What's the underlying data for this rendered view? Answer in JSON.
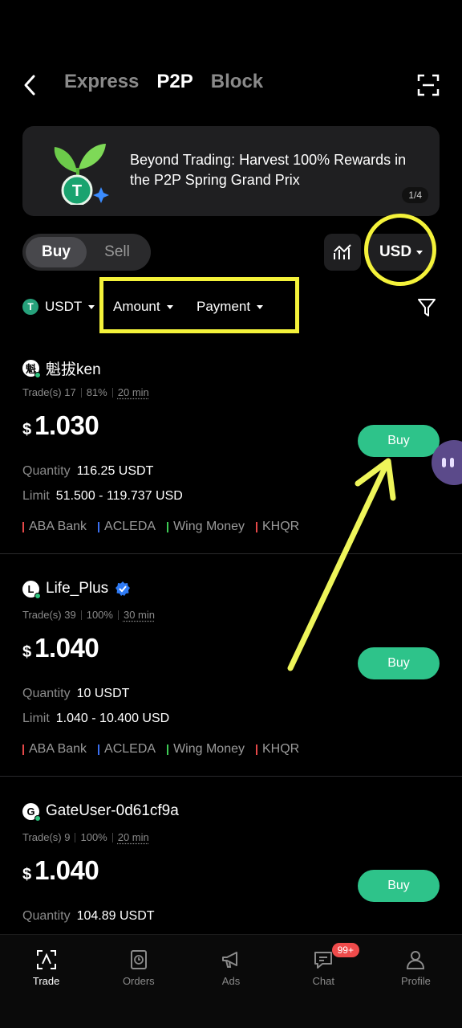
{
  "nav": {
    "tabs": [
      "Express",
      "P2P",
      "Block"
    ],
    "active_tab": "P2P"
  },
  "banner": {
    "text": "Beyond Trading: Harvest 100% Rewards in the P2P Spring Grand Prix",
    "page": "1/4"
  },
  "trade_toggle": {
    "buy": "Buy",
    "sell": "Sell",
    "active": "Buy"
  },
  "currency": "USD",
  "filters": {
    "coin": "USDT",
    "amount": "Amount",
    "payment": "Payment"
  },
  "colors": {
    "buy_green": "#2ec38a",
    "highlight": "#f4f23a"
  },
  "listings": [
    {
      "avatar": "魁",
      "name": "魁拔ken",
      "verified": false,
      "trades": "Trade(s) 17",
      "completion": "81%",
      "time": "20 min",
      "currency_symbol": "$",
      "price": "1.030",
      "quantity_label": "Quantity",
      "quantity": "116.25 USDT",
      "limit_label": "Limit",
      "limit": "51.500 - 119.737 USD",
      "button": "Buy",
      "payments": [
        {
          "name": "ABA Bank",
          "color": "#e54848"
        },
        {
          "name": "ACLEDA",
          "color": "#3b6ff0"
        },
        {
          "name": "Wing Money",
          "color": "#3ecb55"
        },
        {
          "name": "KHQR",
          "color": "#e54848"
        }
      ]
    },
    {
      "avatar": "L",
      "name": "Life_Plus",
      "verified": true,
      "trades": "Trade(s) 39",
      "completion": "100%",
      "time": "30 min",
      "currency_symbol": "$",
      "price": "1.040",
      "quantity_label": "Quantity",
      "quantity": "10 USDT",
      "limit_label": "Limit",
      "limit": "1.040 - 10.400 USD",
      "button": "Buy",
      "payments": [
        {
          "name": "ABA Bank",
          "color": "#e54848"
        },
        {
          "name": "ACLEDA",
          "color": "#3b6ff0"
        },
        {
          "name": "Wing Money",
          "color": "#3ecb55"
        },
        {
          "name": "KHQR",
          "color": "#e54848"
        }
      ]
    },
    {
      "avatar": "G",
      "name": "GateUser-0d61cf9a",
      "verified": false,
      "trades": "Trade(s) 9",
      "completion": "100%",
      "time": "20 min",
      "currency_symbol": "$",
      "price": "1.040",
      "quantity_label": "Quantity",
      "quantity": "104.89 USDT",
      "button": "Buy"
    }
  ],
  "bottom_nav": [
    {
      "label": "Trade",
      "icon": "trade-icon",
      "active": true
    },
    {
      "label": "Orders",
      "icon": "orders-icon",
      "active": false
    },
    {
      "label": "Ads",
      "icon": "megaphone-icon",
      "active": false
    },
    {
      "label": "Chat",
      "icon": "chat-icon",
      "active": false,
      "badge": "99+"
    },
    {
      "label": "Profile",
      "icon": "profile-icon",
      "active": false
    }
  ]
}
